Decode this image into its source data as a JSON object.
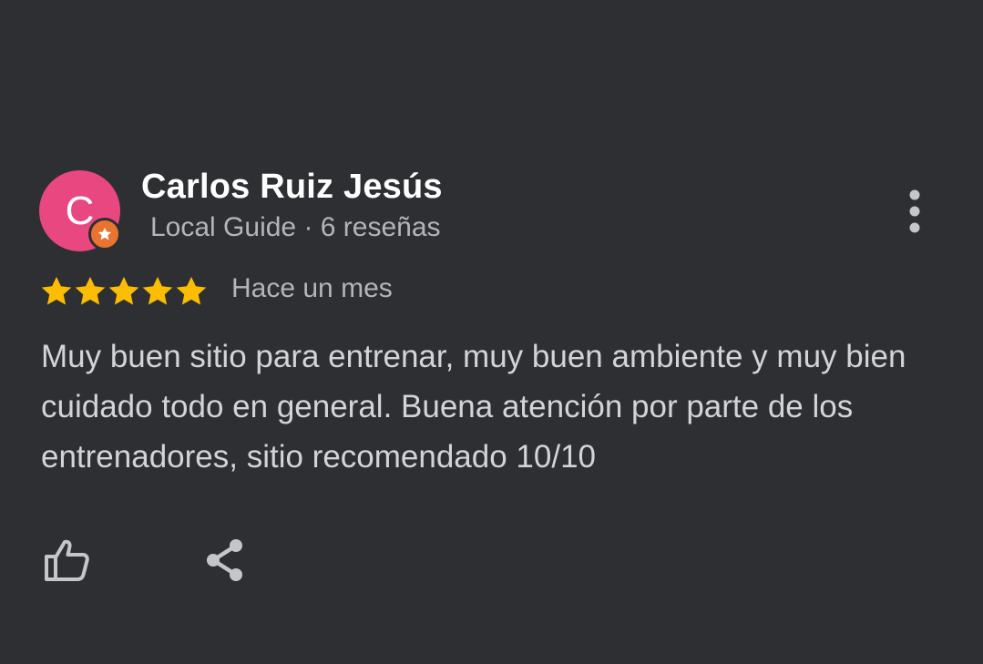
{
  "review": {
    "avatar": {
      "initial": "C",
      "color": "#e8487f",
      "badge_color": "#e8742f",
      "badge_icon": "star-icon"
    },
    "author_name": "Carlos Ruiz Jesús",
    "author_meta": "Local Guide · 6 reseñas",
    "rating": 5,
    "rating_max": 5,
    "star_color": "#fbbc04",
    "date": "Hace un mes",
    "text": "Muy buen sitio para entrenar, muy buen ambiente y muy bien cuidado todo en general. Buena atención por parte de los entrenadores, sitio recomendado 10/10",
    "actions": {
      "more_icon": "more-vert-icon",
      "like_icon": "thumb-up-icon",
      "share_icon": "share-icon"
    }
  }
}
